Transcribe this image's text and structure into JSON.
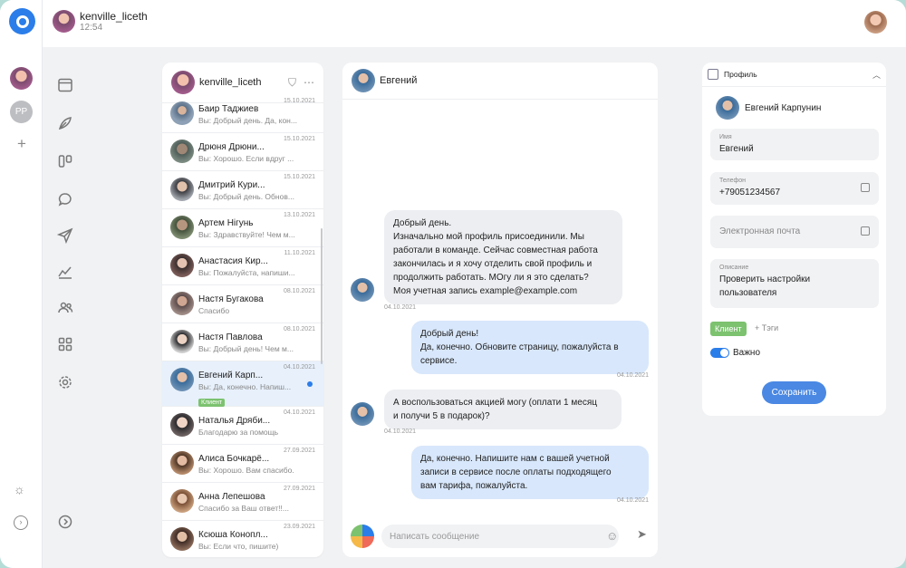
{
  "topbar": {
    "username": "kenville_liceth",
    "time": "12:54"
  },
  "rail": {
    "pp_initials": "PP"
  },
  "chatlist": {
    "account_name": "kenville_liceth",
    "items": [
      {
        "name": "Баир Таджиев",
        "date": "15.10.2021",
        "msg": "Вы: Добрый день. Да, кон..."
      },
      {
        "name": "Дрюня Дрюни...",
        "date": "15.10.2021",
        "msg": "Вы: Хорошо. Если вдруг ..."
      },
      {
        "name": "Дмитрий Кури...",
        "date": "15.10.2021",
        "msg": "Вы: Добрый день. Обнов..."
      },
      {
        "name": "Артем Нігунь",
        "date": "13.10.2021",
        "msg": "Вы: Здравствуйте! Чем м..."
      },
      {
        "name": "Анастасия Кир...",
        "date": "11.10.2021",
        "msg": "Вы: Пожалуйста, напиши..."
      },
      {
        "name": "Настя Бугакова",
        "date": "08.10.2021",
        "msg": "Спасибо"
      },
      {
        "name": "Настя Павлова",
        "date": "08.10.2021",
        "msg": "Вы: Добрый день! Чем м..."
      },
      {
        "name": "Евгений Карп...",
        "date": "04.10.2021",
        "msg": "Вы: Да, конечно. Напиш...",
        "badge": "Клиент"
      },
      {
        "name": "Наталья Дряби...",
        "date": "04.10.2021",
        "msg": "Благодарю за помощь"
      },
      {
        "name": "Алиса Бочкарё...",
        "date": "27.09.2021",
        "msg": "Вы: Хорошо. Вам спасибо."
      },
      {
        "name": "Анна Лепешова",
        "date": "27.09.2021",
        "msg": "Спасибо за Ваш ответ!!..."
      },
      {
        "name": "Ксюша Конопл...",
        "date": "23.09.2021",
        "msg": "Вы: Если что, пишите)"
      }
    ]
  },
  "chat": {
    "contact_name": "Евгений",
    "messages": [
      {
        "dir": "in",
        "lines": [
          "Добрый день.",
          "Изначально мой профиль присоединили. Мы",
          "работали в команде. Сейчас совместная работа",
          "закончилась и я хочу отделить свой профиль и",
          "продолжить работать. МОгу ли я это сделать?",
          "Моя учетная запись example@example.com"
        ],
        "date": "04.10.2021"
      },
      {
        "dir": "out",
        "lines": [
          "Добрый день!",
          "Да, конечно. Обновите страницу, пожалуйста в",
          "сервисе."
        ],
        "date": "04.10.2021"
      },
      {
        "dir": "in",
        "lines": [
          "А воспользоваться акцией могу (оплати 1 месяц",
          "и получи 5 в подарок)?"
        ],
        "date": "04.10.2021"
      },
      {
        "dir": "out",
        "lines": [
          "Да, конечно. Напишите нам с вашей учетной",
          "записи в сервисе после оплаты подходящего",
          "вам тарифа, пожалуйста."
        ],
        "date": "04.10.2021"
      }
    ],
    "input_placeholder": "Написать сообщение"
  },
  "profile": {
    "title": "Профиль",
    "full_name": "Евгений Карпунин",
    "name_label": "Имя",
    "name_value": "Евгений",
    "phone_label": "Телефон",
    "phone_value": "+79051234567",
    "email_placeholder": "Электронная почта",
    "desc_label": "Описание",
    "desc_value": "Проверить настройки пользователя",
    "tag": "Клиент",
    "tags_add": "+ Тэги",
    "important_label": "Важно",
    "important_on": true,
    "save_label": "Сохранить"
  },
  "colors": {
    "accent": "#2b7de9",
    "tag_green": "#7cc26f",
    "bubble_out": "#d8e7fb",
    "bubble_in": "#eceef1"
  }
}
